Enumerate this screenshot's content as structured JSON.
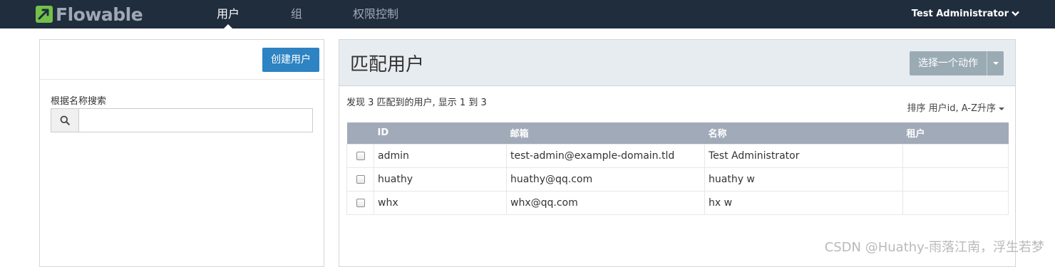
{
  "brand": {
    "name": "Flowable",
    "accent": "#73c14a"
  },
  "nav": {
    "tabs": [
      {
        "label": "用户",
        "active": true
      },
      {
        "label": "组",
        "active": false
      },
      {
        "label": "权限控制",
        "active": false
      }
    ],
    "user": "Test Administrator",
    "user_icon": "chevron-down-icon"
  },
  "left": {
    "create_button": "创建用户",
    "search_label": "根据名称搜索",
    "search_value": "",
    "search_icon": "search-icon"
  },
  "main": {
    "title": "匹配用户",
    "action_button": "选择一个动作",
    "summary": "发现 3 匹配到的用户, 显示 1 到 3",
    "sort": "排序 用户id, A-Z升序"
  },
  "table": {
    "columns": [
      "",
      "ID",
      "邮箱",
      "名称",
      "租户"
    ],
    "rows": [
      {
        "id": "admin",
        "email": "test-admin@example-domain.tld",
        "name": "Test Administrator",
        "tenant": ""
      },
      {
        "id": "huathy",
        "email": "huathy@qq.com",
        "name": "huathy w",
        "tenant": ""
      },
      {
        "id": "whx",
        "email": "whx@qq.com",
        "name": "hx w",
        "tenant": ""
      }
    ]
  },
  "watermark": "CSDN @Huathy-雨落江南，浮生若梦"
}
